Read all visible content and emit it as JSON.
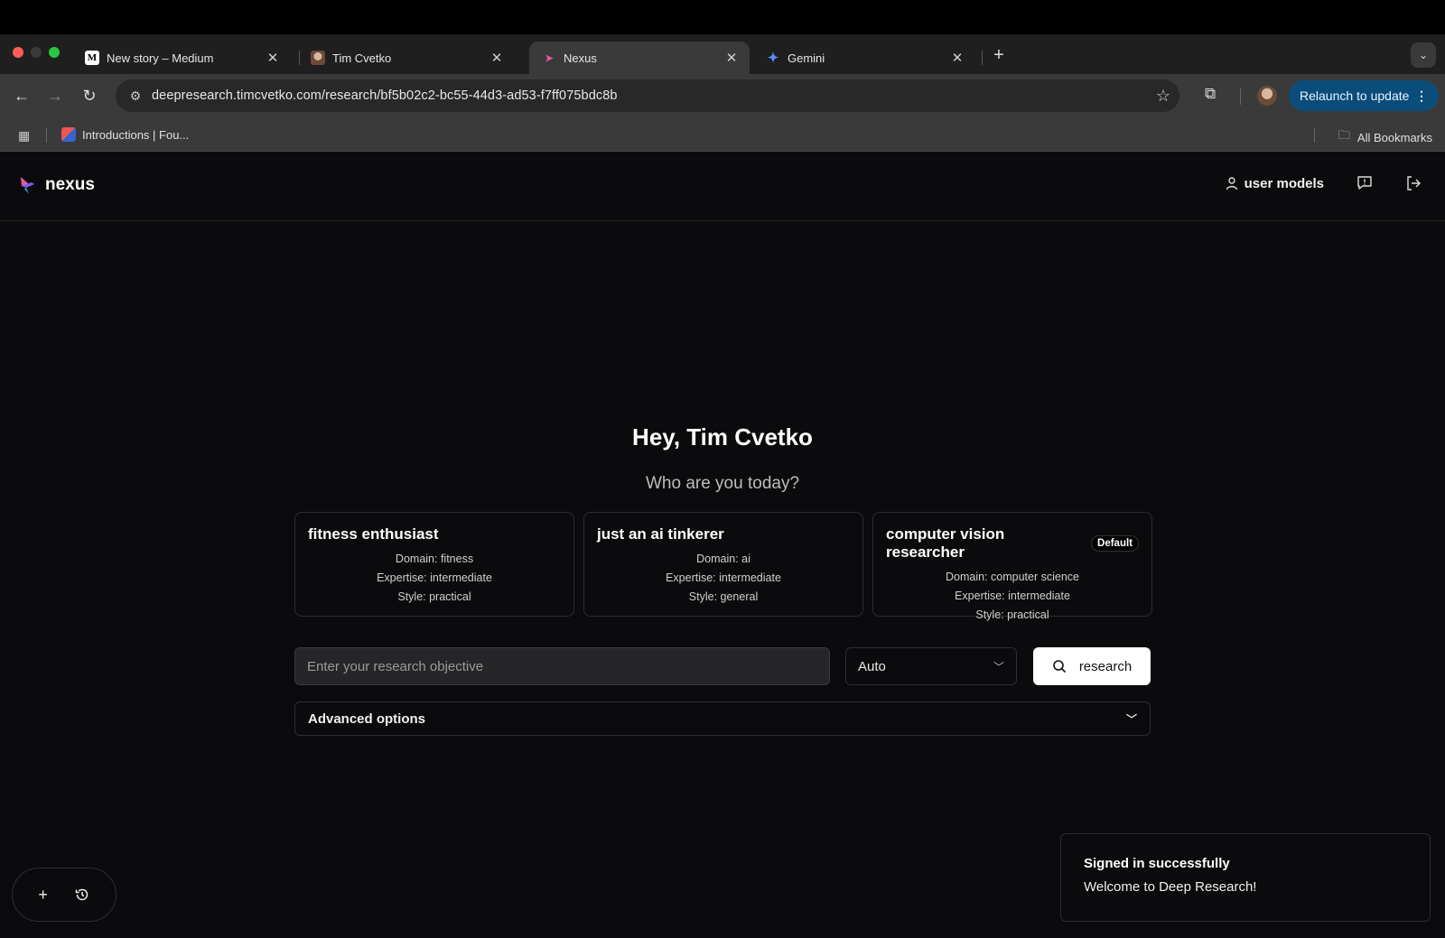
{
  "browser": {
    "tabs": [
      {
        "title": "New story – Medium",
        "favicon": "medium-icon"
      },
      {
        "title": "Tim Cvetko",
        "favicon": "profile-photo-icon"
      },
      {
        "title": "Nexus",
        "favicon": "hummingbird-icon"
      },
      {
        "title": "Gemini",
        "favicon": "gemini-sparkle-icon"
      }
    ],
    "active_tab": 2,
    "url": "deepresearch.timcvetko.com/research/bf5b02c2-bc55-44d3-ad53-f7ff075bdc8b",
    "relaunch_label": "Relaunch to update",
    "bookmarks": [
      {
        "label": "Introductions | Fou..."
      }
    ],
    "all_bookmarks_label": "All Bookmarks",
    "accent": "#0b4d7a"
  },
  "app": {
    "brand": "nexus",
    "header": {
      "user_models_label": "user models"
    },
    "greeting": "Hey, Tim Cvetko",
    "subtitle": "Who are you today?",
    "personas": [
      {
        "title": "fitness enthusiast",
        "domain": "Domain: fitness",
        "expertise": "Expertise: intermediate",
        "style": "Style: practical",
        "badge": ""
      },
      {
        "title": "just an ai tinkerer",
        "domain": "Domain: ai",
        "expertise": "Expertise: intermediate",
        "style": "Style: general",
        "badge": ""
      },
      {
        "title": "computer vision researcher",
        "domain": "Domain: computer science",
        "expertise": "Expertise: intermediate",
        "style": "Style: practical",
        "badge": "Default"
      }
    ],
    "search": {
      "placeholder": "Enter your research objective",
      "value": "",
      "mode": "Auto",
      "button_label": "research"
    },
    "advanced_label": "Advanced options",
    "toast": {
      "title": "Signed in successfully",
      "message": "Welcome to Deep Research!"
    }
  }
}
